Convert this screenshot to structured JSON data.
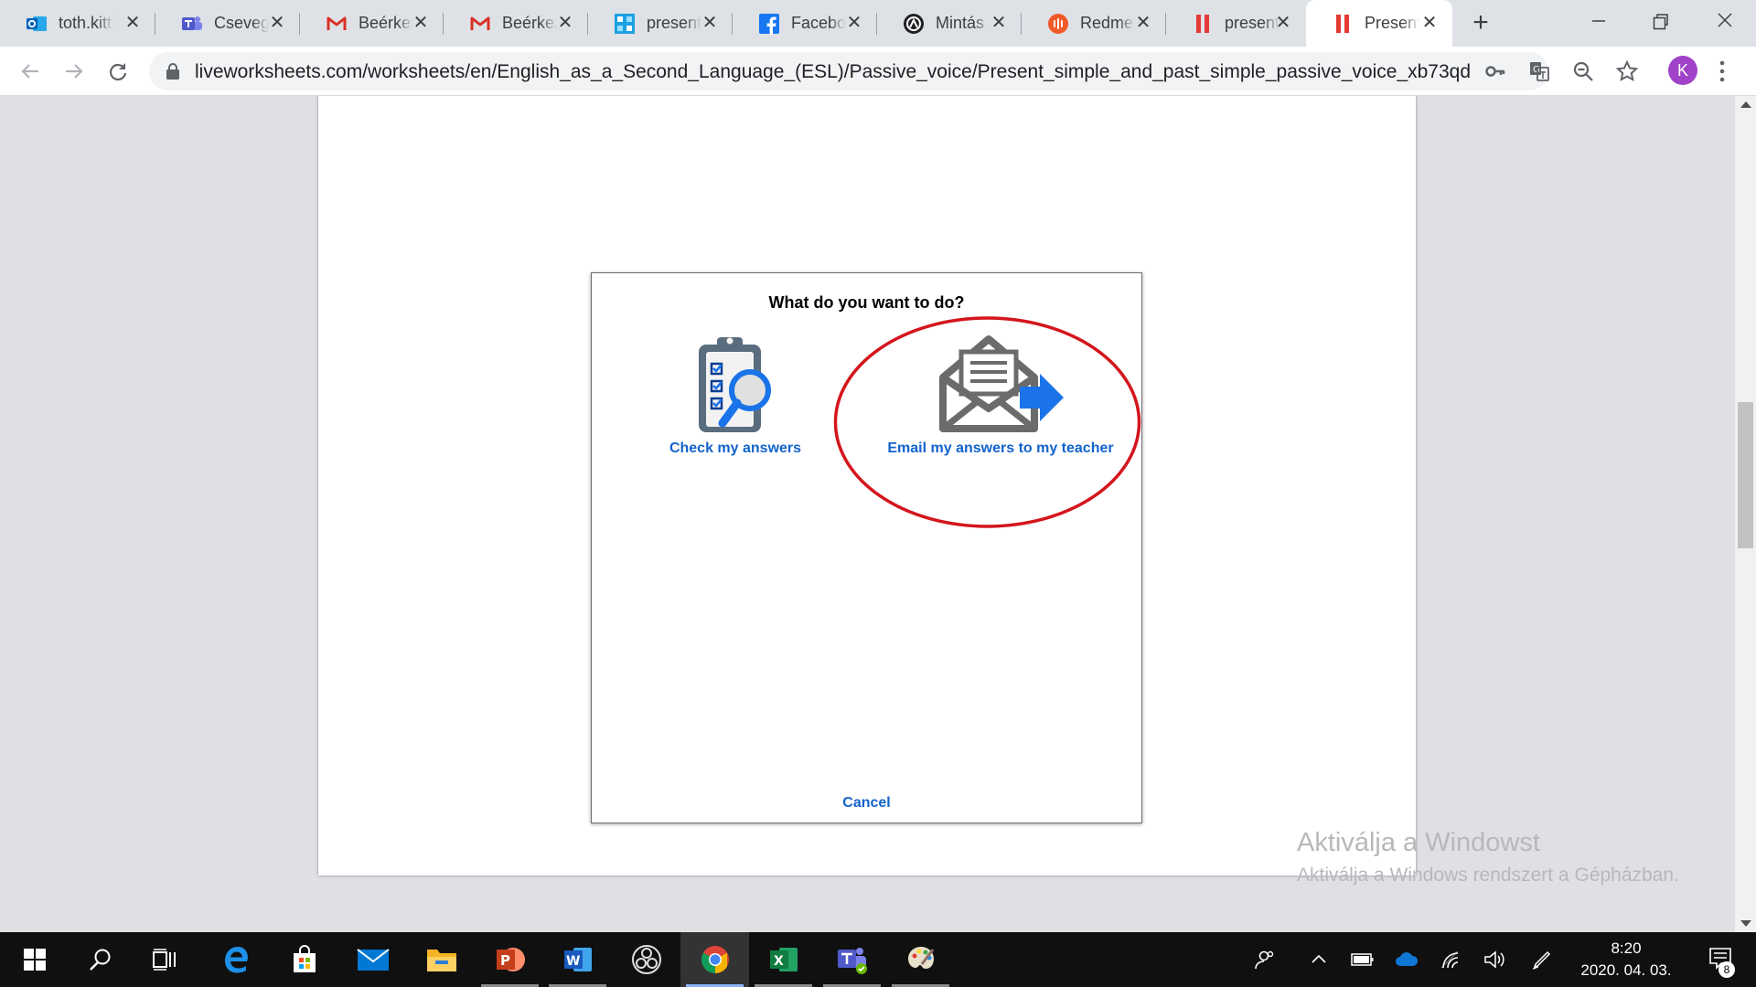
{
  "browser": {
    "tabs": [
      {
        "label": "toth.kitti",
        "favicon": "outlook-icon"
      },
      {
        "label": "Csevegés",
        "favicon": "teams-icon"
      },
      {
        "label": "Beérkezett",
        "favicon": "gmail-icon"
      },
      {
        "label": "Beérkezett",
        "favicon": "gmail-icon"
      },
      {
        "label": "presentation",
        "favicon": "tiles-icon"
      },
      {
        "label": "Facebook",
        "favicon": "facebook-icon"
      },
      {
        "label": "Mintás",
        "favicon": "minta-icon"
      },
      {
        "label": "Redmenta",
        "favicon": "redmenta-icon"
      },
      {
        "label": "present",
        "favicon": "liveworksheets-icon"
      },
      {
        "label": "Present",
        "favicon": "liveworksheets-icon",
        "active": true
      }
    ],
    "url": "liveworksheets.com/worksheets/en/English_as_a_Second_Language_(ESL)/Passive_voice/Present_simple_and_past_simple_passive_voice_xb73qd",
    "profile_initial": "K"
  },
  "dialog": {
    "title": "What do you want to do?",
    "option_check": "Check my answers",
    "option_email": "Email my answers to my teacher",
    "cancel": "Cancel"
  },
  "watermark": {
    "line1": "Aktiválja a Windowst",
    "line2": "Aktiválja a Windows rendszert a Gépházban."
  },
  "taskbar": {
    "time": "8:20",
    "date": "2020. 04. 03.",
    "notifications": "8"
  },
  "colors": {
    "link": "#1263cc",
    "highlight": "#d4151c",
    "taskbar": "#101010"
  }
}
